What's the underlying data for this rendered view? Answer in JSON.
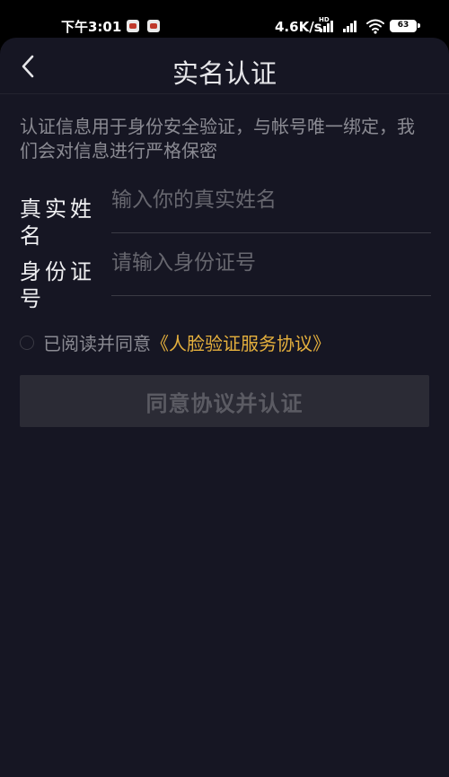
{
  "status_bar": {
    "time": "下午3:01",
    "network_speed": "4.6K/s",
    "network_badge": "HD",
    "battery": "63",
    "icons": [
      "app-notification-icon",
      "app-notification-icon",
      "hd-signal-icon",
      "signal-icon",
      "wifi-icon",
      "battery-icon"
    ]
  },
  "nav": {
    "title": "实名认证",
    "back_icon": "chevron-left-icon"
  },
  "intro": "认证信息用于身份安全验证，与帐号唯一绑定，我们会对信息进行严格保密",
  "form": {
    "name_label": "真实姓名",
    "name_placeholder": "输入你的真实姓名",
    "name_value": "",
    "id_label": "身份证号",
    "id_placeholder": "请输入身份证号",
    "id_value": ""
  },
  "agreement": {
    "checked": false,
    "text": "已阅读并同意",
    "link": "《人脸验证服务协议》"
  },
  "submit_label": "同意协议并认证",
  "colors": {
    "background": "#161623",
    "accent": "#e5b03d",
    "button_disabled": "#2b2b35"
  }
}
